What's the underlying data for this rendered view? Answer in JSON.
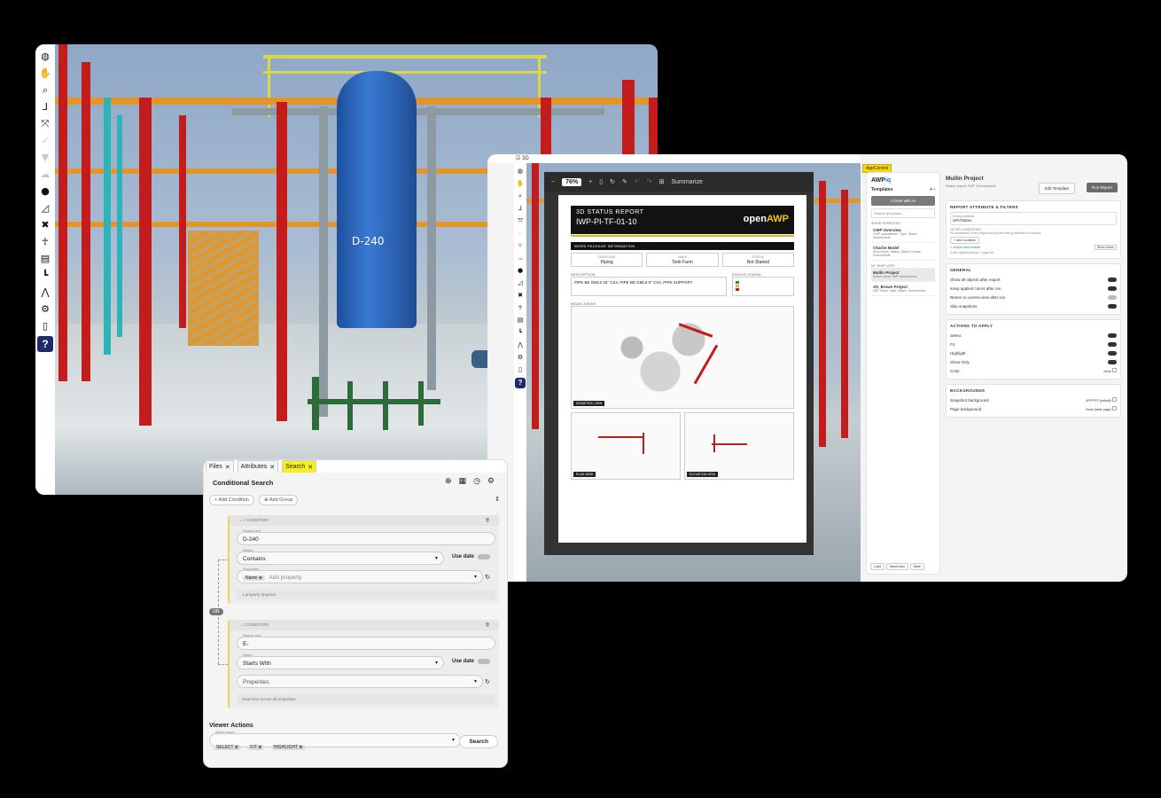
{
  "viewer": {
    "vessel_label": "D-240",
    "help_label": "?",
    "toolbar_icons": [
      "globe-icon",
      "hand-icon",
      "zoom-icon",
      "axis-icon",
      "fit-icon",
      "check-icon",
      "filter-icon",
      "cloud-icon",
      "drop-icon",
      "measure-icon",
      "tools-icon",
      "person-icon",
      "table-icon",
      "tree-icon",
      "graph-icon",
      "settings-icon",
      "document-icon",
      "help-icon"
    ]
  },
  "report_window": {
    "topbar_label": "3D",
    "pdf_toolbar": {
      "zoom": "76%",
      "minus": "−",
      "plus": "+",
      "summarize": "Summarize"
    },
    "report": {
      "header_title": "3D STATUS REPORT",
      "header_id": "IWP-PI-TF-01-10",
      "logo_open": "open",
      "logo_awp": "AWP",
      "section_work_package": "WORK PACKAGE INFORMATION",
      "wp_cells": [
        {
          "key": "DISCIPLINE",
          "value": "Piping"
        },
        {
          "key": "AREA",
          "value": "Tank Farm"
        },
        {
          "key": "STATUS",
          "value": "Not Started"
        }
      ],
      "description_label": "DESCRIPTION",
      "description": "PIPE BE GML5 16\" CS4, PIPE BE GML5 6\" CS4, PIPE SUPPORT",
      "status_legend_label": "STATUS LEGEND",
      "model_views_label": "MODEL VIEWS",
      "view_tags": [
        "ISOMETRIC VIEW",
        "PLAN VIEW",
        "ELEVATION VIEW"
      ]
    },
    "app_control_tag": "AppControl",
    "templates_panel": {
      "brand_prefix": "AWP",
      "brand_suffix": "iq",
      "title": "Templates",
      "create_button": "Create with AI",
      "search_placeholder": "Search templates...",
      "admin_label": "ADMIN TEMPLATES",
      "my_label": "MY TEMPLATES",
      "admin_templates": [
        {
          "name": "CWP Overview",
          "desc": "CWP spreadsheet, Type, Status, Screenshots"
        },
        {
          "name": "Charlie Model",
          "desc": "Area report: Status, Object Counts, Screenshots"
        }
      ],
      "my_templates": [
        {
          "name": "Mullin Project",
          "desc": "Status report: IWP, Screenshots"
        },
        {
          "name": "Alt_Brown Project",
          "desc": "IWP Sheet, Type, Status, Screenshots"
        }
      ],
      "footer": [
        "Load",
        "Import xlsx",
        "Save"
      ]
    },
    "main_panel": {
      "title": "Mullin Project",
      "subtitle": "Status report: IWP, Screenshots",
      "edit_button": "Edit Template",
      "run_button": "Run Report",
      "sections": {
        "attr_filters": "REPORT ATTRIBUTE & FILTERS",
        "driving_attribute_label": "Driving attribute",
        "driving_attribute": "UPI/Status",
        "filter_conditions": "FILTER CONDITIONS",
        "filter_note": "No conditions: Every object among the driving attribute is included.",
        "add_condition": "+ Add Condition",
        "unique_note": "1 unique value loaded",
        "objects_note": "3,094 objects across 1 page set",
        "show_colors": "Show colors",
        "general": "GENERAL",
        "general_rows": [
          "Show all objects after export",
          "Keep applied colors after run",
          "Return to current view after run",
          "Skip snapshots"
        ],
        "actions": "ACTIONS TO APPLY",
        "action_rows": [
          "Select",
          "Fit",
          "Highlight",
          "Show Only",
          "Color"
        ],
        "color_value": "None",
        "backgrounds": "BACKGROUNDS",
        "bg_rows": [
          {
            "label": "Snapshot background",
            "value": "#FFFFFF (default)"
          },
          {
            "label": "Page background",
            "value": "None (white page)"
          }
        ]
      }
    }
  },
  "search_panel": {
    "tabs": [
      "Files",
      "Attributes",
      "Search"
    ],
    "title": "Conditional Search",
    "add_condition": "Add Condition",
    "add_group": "Add Group",
    "condition_header": "CONDITION",
    "or_label": "OR",
    "conditions": [
      {
        "search_text_label": "Search text",
        "search_text": "D-240",
        "match_label": "Match",
        "match": "Contains",
        "use_date": "Use date",
        "properties_label": "Properties",
        "property_chip": "Name",
        "property_placeholder": "Add property",
        "note": "1 property targeted"
      },
      {
        "search_text_label": "Search text",
        "search_text": "E-",
        "match_label": "Match",
        "match": "Starts With",
        "use_date": "Use date",
        "properties_label": "",
        "property_placeholder": "Properties",
        "note": "Searches across all properties."
      }
    ],
    "viewer_actions": "Viewer Actions",
    "when_found_label": "When found",
    "action_chips": [
      "SELECT",
      "FIT",
      "HIGHLIGHT"
    ],
    "search_button": "Search"
  }
}
